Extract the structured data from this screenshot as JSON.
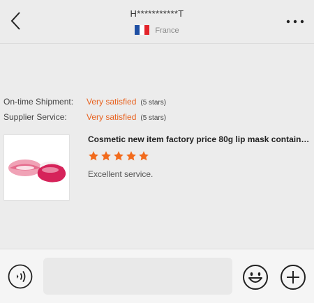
{
  "header": {
    "contact_name": "H***********T",
    "country": "France"
  },
  "ratings": [
    {
      "label": "On-time Shipment:",
      "value": "Very satisfied",
      "stars_note": "(5 stars)"
    },
    {
      "label": "Supplier Service:",
      "value": "Very satisfied",
      "stars_note": "(5 stars)"
    }
  ],
  "review": {
    "product_title": "Cosmetic new item factory price 80g lip mask contain…",
    "rating": 5,
    "text": "Excellent service."
  },
  "composer": {
    "placeholder": ""
  },
  "colors": {
    "accent": "#e8611e",
    "star": "#f26b1d"
  },
  "icons": {
    "back": "chevron-left-icon",
    "more": "more-dots-icon",
    "voice": "voice-icon",
    "emoji": "smiley-icon",
    "add": "plus-circle-icon"
  }
}
